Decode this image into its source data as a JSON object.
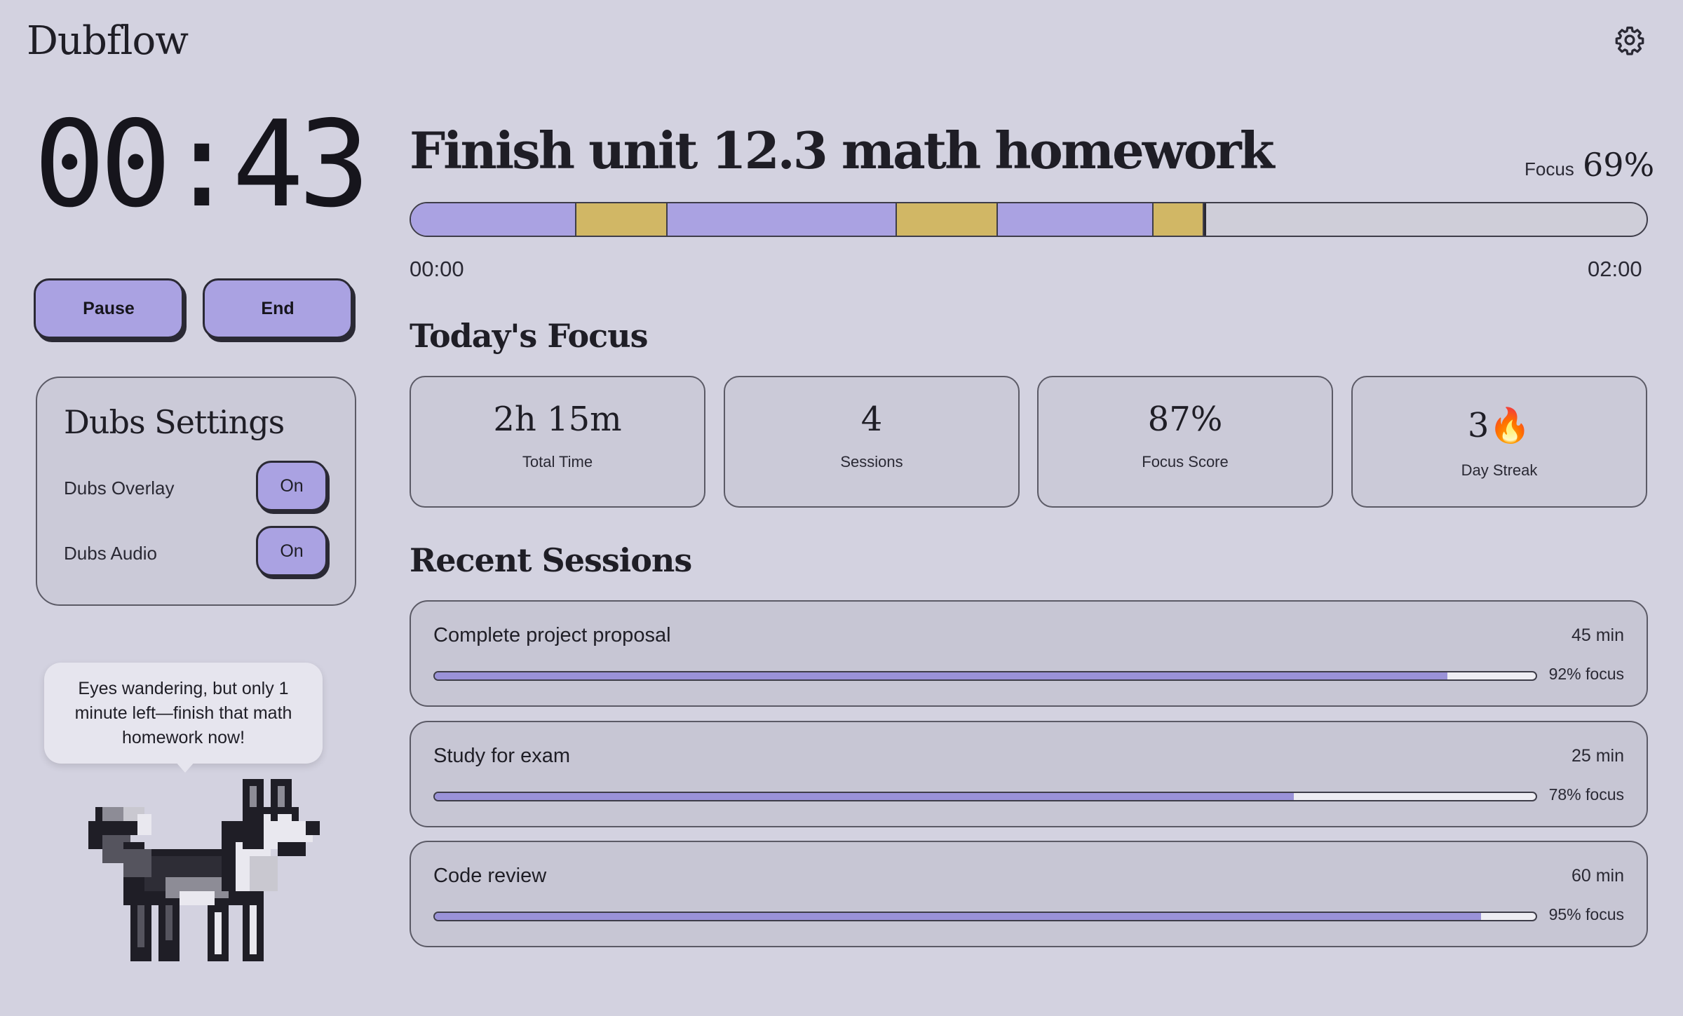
{
  "app": {
    "title": "Dubflow",
    "settings_icon": "gear-icon"
  },
  "timer": {
    "display": "00:43",
    "pause_label": "Pause",
    "end_label": "End"
  },
  "dubs_settings": {
    "title": "Dubs Settings",
    "overlay_label": "Dubs Overlay",
    "overlay_value": "On",
    "audio_label": "Dubs Audio",
    "audio_value": "On"
  },
  "companion": {
    "message": "Eyes wandering, but only 1 minute left—finish that math homework now!",
    "avatar": "husky-dog-pixel-art"
  },
  "task": {
    "title": "Finish unit 12.3 math homework",
    "focus_label": "Focus",
    "focus_value": "69%",
    "timeline_start": "00:00",
    "timeline_end": "02:00",
    "timeline_progress": 0.642,
    "timeline_segments": [
      {
        "state": "focused",
        "from": 0.0,
        "to": 0.133
      },
      {
        "state": "distracted",
        "from": 0.133,
        "to": 0.208
      },
      {
        "state": "focused",
        "from": 0.208,
        "to": 0.392
      },
      {
        "state": "distracted",
        "from": 0.392,
        "to": 0.475
      },
      {
        "state": "focused",
        "from": 0.475,
        "to": 0.6
      },
      {
        "state": "distracted",
        "from": 0.6,
        "to": 0.642
      }
    ]
  },
  "today": {
    "title": "Today's Focus",
    "stats": [
      {
        "value": "2h 15m",
        "label": "Total Time"
      },
      {
        "value": "4",
        "label": "Sessions"
      },
      {
        "value": "87%",
        "label": "Focus Score"
      },
      {
        "value": "3🔥",
        "label": "Day Streak"
      }
    ]
  },
  "recent": {
    "title": "Recent Sessions",
    "sessions": [
      {
        "name": "Complete project proposal",
        "duration": "45 min",
        "focus": 0.92,
        "focus_label": "92% focus"
      },
      {
        "name": "Study for exam",
        "duration": "25 min",
        "focus": 0.78,
        "focus_label": "78% focus"
      },
      {
        "name": "Code review",
        "duration": "60 min",
        "focus": 0.95,
        "focus_label": "95% focus"
      }
    ]
  },
  "colors": {
    "background": "#d3d2e0",
    "accent_purple": "#aaa2e2",
    "distraction_gold": "#d1b765",
    "text_dark": "#1f1e26"
  }
}
